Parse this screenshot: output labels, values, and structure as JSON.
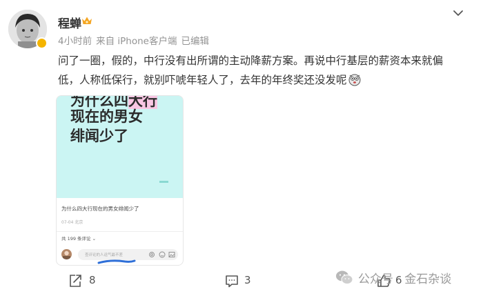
{
  "post": {
    "author": "程蝉",
    "meta": {
      "time": "4小时前",
      "source": "来自 iPhone客户端",
      "edited": "已编辑"
    },
    "text_line1": "问了一圈，假的，中行没有出所谓的主动降薪方案。再说中行基层的薪资本来就偏",
    "text_line2": "低，人称低保行，就别吓唬年轻人了，去年的年终奖还没发呢"
  },
  "media_card": {
    "ghost_title_pre": "为什么四",
    "ghost_title_hl": "大行",
    "cover_line1": "现在的男女",
    "cover_line2": "绯闻少了",
    "title": "为什么四大行现在的男女绯闻少了",
    "date": "07-04 北京",
    "comments_count": "共 199 条评论 ⌄",
    "comment_placeholder": "查评论的人运气最不差"
  },
  "actions": {
    "repost_count": "8",
    "comment_count": "3",
    "like_count": "6"
  },
  "watermark": {
    "text": "公众号 · 金石杂谈"
  },
  "colors": {
    "card_cover_bg": "#cbf5f3",
    "highlight_pink": "#f9c7e4",
    "vip_gold": "#f4b400",
    "text": "#333333",
    "meta": "#939393"
  },
  "icons": [
    "more-chevron-icon",
    "crown-icon",
    "emoji-icon",
    "repost-icon",
    "comment-icon",
    "like-icon"
  ]
}
